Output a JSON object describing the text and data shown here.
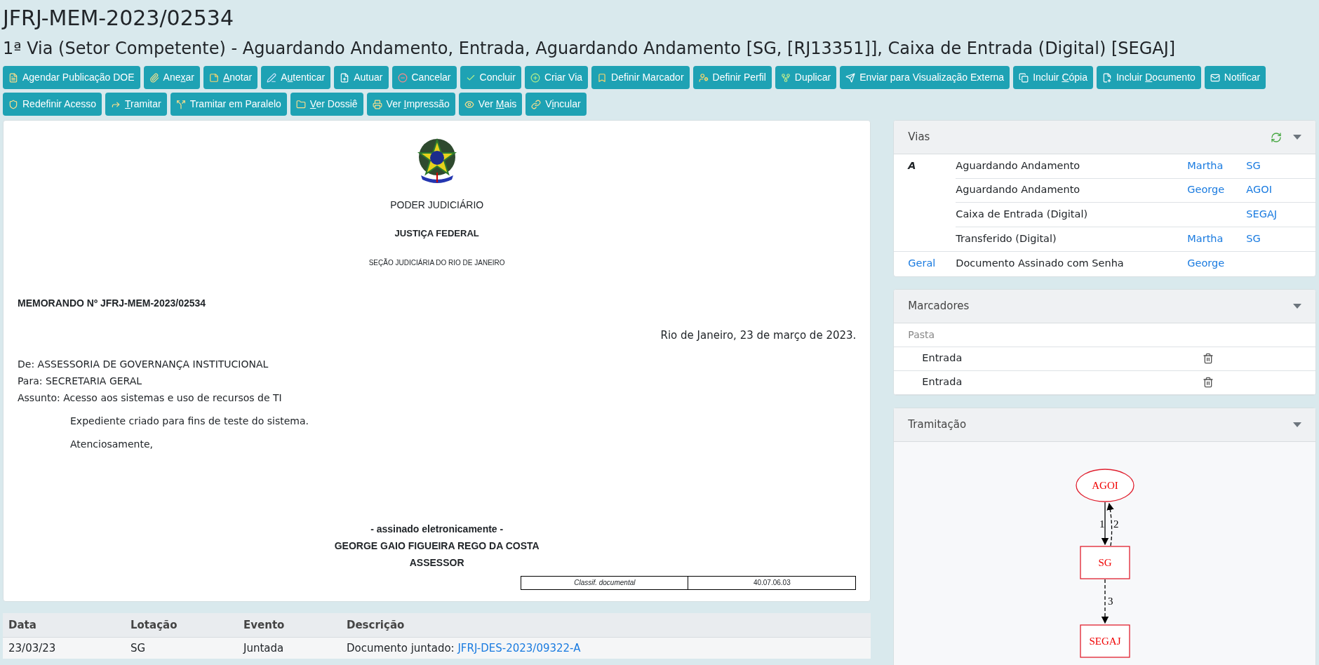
{
  "title": "JFRJ-MEM-2023/02534",
  "subtitle": "1ª Via (Setor Competente) - Aguardando Andamento, Entrada, Aguardando Andamento [SG, [RJ13351]], Caixa de Entrada (Digital) [SEGAJ]",
  "toolbar": [
    [
      {
        "label": "Agendar Publicação DOE"
      },
      {
        "pre": "Ane",
        "key": "x",
        "post": "ar"
      },
      {
        "key": "A",
        "post": "notar"
      },
      {
        "pre": "A",
        "key": "u",
        "post": "tenticar"
      },
      {
        "label": "Autuar"
      },
      {
        "label": "Cancelar"
      },
      {
        "label": "Concluir"
      },
      {
        "label": "Criar Via"
      },
      {
        "label": "Definir Marcador"
      },
      {
        "label": "Definir Perfil"
      },
      {
        "label": "Duplicar"
      },
      {
        "label": "Enviar para Visualização Externa"
      },
      {
        "pre": "Incluir ",
        "key": "C",
        "post": "ópia"
      },
      {
        "pre": "Incluir ",
        "key": "D",
        "post": "ocumento"
      },
      {
        "label": "Notificar"
      }
    ],
    [
      {
        "label": "Redefinir Acesso"
      },
      {
        "key": "T",
        "post": "ramitar"
      },
      {
        "label": "Tramitar em Paralelo"
      },
      {
        "key": "V",
        "post": "er Dossiê"
      },
      {
        "pre": "Ver ",
        "key": "I",
        "post": "mpressão"
      },
      {
        "pre": "Ver ",
        "key": "M",
        "post": "ais"
      },
      {
        "pre": "V",
        "key": "i",
        "post": "ncular"
      }
    ]
  ],
  "document": {
    "header": [
      "PODER JUDICIÁRIO",
      "JUSTIÇA FEDERAL",
      "SEÇÃO JUDICIÁRIA DO RIO DE JANEIRO"
    ],
    "number": "MEMORANDO Nº JFRJ-MEM-2023/02534",
    "date": "Rio de Janeiro, 23 de março de 2023.",
    "fields": [
      "De: ASSESSORIA DE GOVERNANÇA INSTITUCIONAL",
      "Para: SECRETARIA GERAL",
      "Assunto: Acesso aos sistemas e uso de recursos de TI"
    ],
    "paragraphs": [
      "Expediente criado para fins de teste do sistema.",
      "Atenciosamente,"
    ],
    "signature": [
      "- assinado eletronicamente -",
      "GEORGE GAIO FIGUEIRA REGO DA COSTA",
      "ASSESSOR"
    ],
    "classification": {
      "label": "Classif. documental",
      "value": "40.07.06.03"
    }
  },
  "movements": {
    "columns": [
      "Data",
      "Lotação",
      "Evento",
      "Descrição"
    ],
    "rows": [
      {
        "date": "23/03/23",
        "unit": "SG",
        "event": "Juntada",
        "description": "Documento juntado: ",
        "link": "JFRJ-DES-2023/09322-A"
      }
    ]
  },
  "vias": {
    "title": "Vias",
    "rows": [
      {
        "group": "A",
        "kind": "mark",
        "status": "Aguardando Andamento",
        "person": "Martha",
        "unit": "SG"
      },
      {
        "status": "Aguardando Andamento",
        "person": "George",
        "unit": "AGOI"
      },
      {
        "status": "Caixa de Entrada (Digital)",
        "unit": "SEGAJ"
      },
      {
        "status": "Transferido (Digital)",
        "person": "Martha",
        "unit": "SG"
      },
      {
        "group": "Geral",
        "kind": "link",
        "status": "Documento Assinado com Senha",
        "person": "George"
      }
    ]
  },
  "markers": {
    "title": "Marcadores",
    "group": "Pasta",
    "items": [
      "Entrada",
      "Entrada"
    ]
  },
  "routing": {
    "title": "Tramitação",
    "nodes": [
      {
        "label": "AGOI",
        "kind": "ellipse"
      },
      {
        "label": "SG",
        "kind": "box"
      },
      {
        "label": "SEGAJ",
        "kind": "box"
      }
    ],
    "edges": [
      {
        "label": "1",
        "dashed": false
      },
      {
        "label": "2",
        "dashed": true
      },
      {
        "label": "3",
        "dashed": true
      }
    ]
  }
}
